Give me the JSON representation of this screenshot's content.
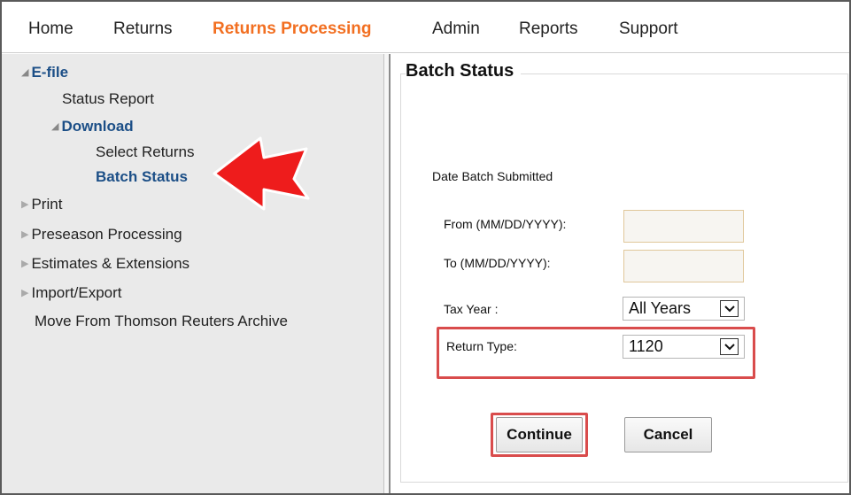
{
  "nav": {
    "items": [
      {
        "label": "Home",
        "active": false
      },
      {
        "label": "Returns",
        "active": false
      },
      {
        "label": "Returns Processing",
        "active": true
      },
      {
        "label": "Admin",
        "active": false
      },
      {
        "label": "Reports",
        "active": false
      },
      {
        "label": "Support",
        "active": false
      }
    ],
    "active_color": "#f26f21"
  },
  "sidebar": {
    "efile": "E-file",
    "status_report": "Status Report",
    "download": "Download",
    "select_returns": "Select Returns",
    "batch_status": "Batch Status",
    "print": "Print",
    "preseason": "Preseason Processing",
    "estimates": "Estimates & Extensions",
    "import_export": "Import/Export",
    "move_archive": "Move From Thomson Reuters Archive"
  },
  "main": {
    "title": "Batch Status",
    "date_section_label": "Date Batch Submitted",
    "from_label": "From (MM/DD/YYYY):",
    "from_value": "",
    "to_label": "To (MM/DD/YYYY):",
    "to_value": "",
    "tax_year_label": "Tax Year :",
    "tax_year_value": "All Years",
    "return_type_label": "Return Type:",
    "return_type_value": "1120",
    "continue_label": "Continue",
    "cancel_label": "Cancel"
  },
  "colors": {
    "tree_link": "#1c4f87",
    "annotation_red": "#d94c4c",
    "arrow_red": "#ee1c1c"
  }
}
